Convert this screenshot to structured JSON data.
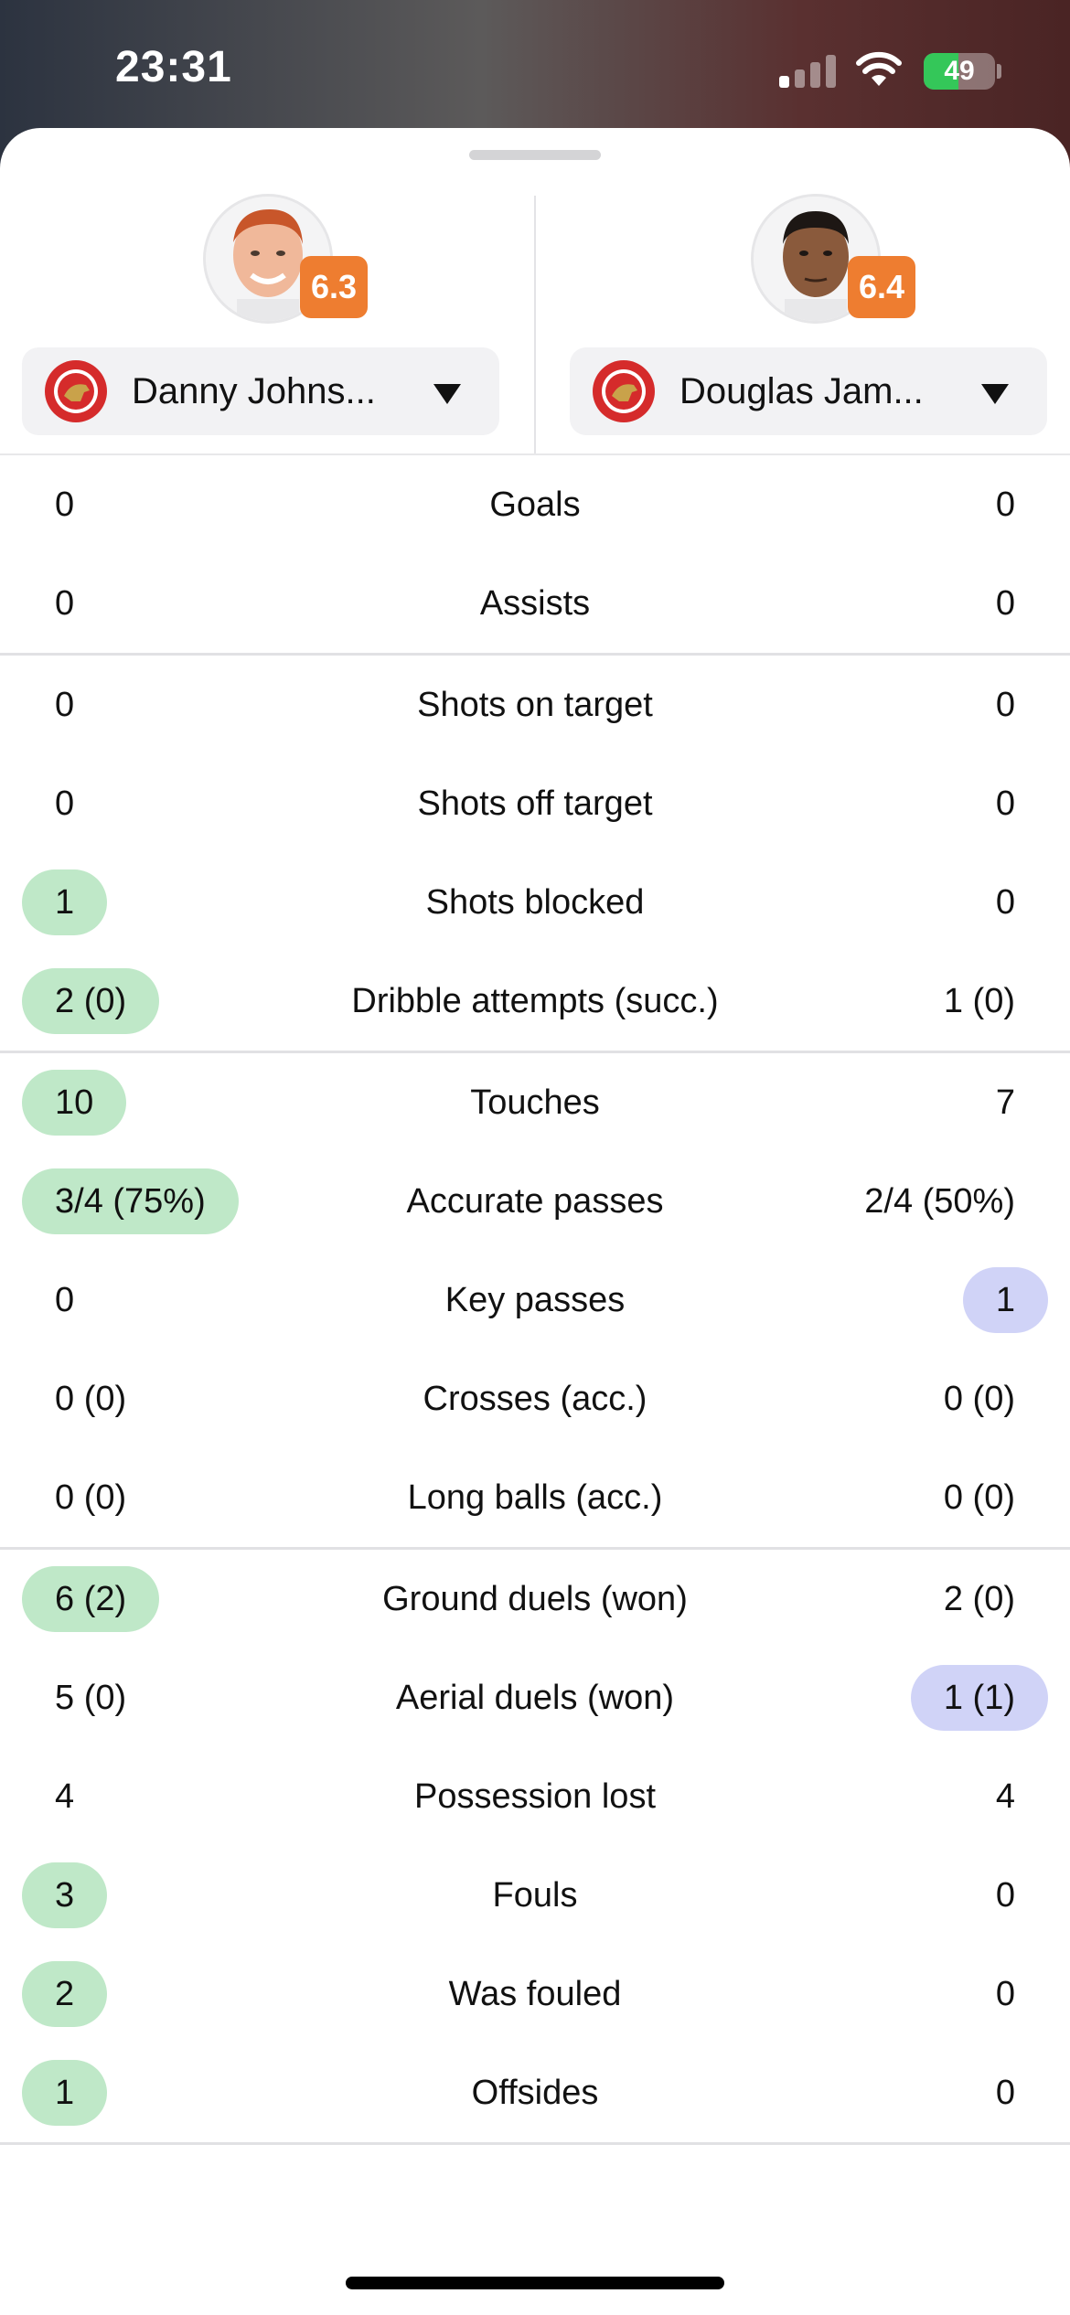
{
  "status_bar": {
    "time": "23:31",
    "battery": "49",
    "battery_level": 0.49
  },
  "players": [
    {
      "name": "Danny Johns...",
      "rating": "6.3"
    },
    {
      "name": "Douglas Jam...",
      "rating": "6.4"
    }
  ],
  "colors": {
    "rating_badge": "#ee7d30",
    "highlight_left": "#bfe8c8",
    "highlight_right": "#d0d3f7",
    "crest_red": "#d52b2b"
  },
  "stat_groups": [
    [
      {
        "label": "Goals",
        "left": "0",
        "right": "0",
        "hl": ""
      },
      {
        "label": "Assists",
        "left": "0",
        "right": "0",
        "hl": ""
      }
    ],
    [
      {
        "label": "Shots on target",
        "left": "0",
        "right": "0",
        "hl": ""
      },
      {
        "label": "Shots off target",
        "left": "0",
        "right": "0",
        "hl": ""
      },
      {
        "label": "Shots blocked",
        "left": "1",
        "right": "0",
        "hl": "left"
      },
      {
        "label": "Dribble attempts (succ.)",
        "left": "2 (0)",
        "right": "1 (0)",
        "hl": "left"
      }
    ],
    [
      {
        "label": "Touches",
        "left": "10",
        "right": "7",
        "hl": "left"
      },
      {
        "label": "Accurate passes",
        "left": "3/4 (75%)",
        "right": "2/4 (50%)",
        "hl": "left"
      },
      {
        "label": "Key passes",
        "left": "0",
        "right": "1",
        "hl": "right"
      },
      {
        "label": "Crosses (acc.)",
        "left": "0 (0)",
        "right": "0 (0)",
        "hl": ""
      },
      {
        "label": "Long balls (acc.)",
        "left": "0 (0)",
        "right": "0 (0)",
        "hl": ""
      }
    ],
    [
      {
        "label": "Ground duels (won)",
        "left": "6 (2)",
        "right": "2 (0)",
        "hl": "left"
      },
      {
        "label": "Aerial duels (won)",
        "left": "5 (0)",
        "right": "1 (1)",
        "hl": "right"
      },
      {
        "label": "Possession lost",
        "left": "4",
        "right": "4",
        "hl": ""
      },
      {
        "label": "Fouls",
        "left": "3",
        "right": "0",
        "hl": "left"
      },
      {
        "label": "Was fouled",
        "left": "2",
        "right": "0",
        "hl": "left"
      },
      {
        "label": "Offsides",
        "left": "1",
        "right": "0",
        "hl": "left"
      }
    ]
  ]
}
